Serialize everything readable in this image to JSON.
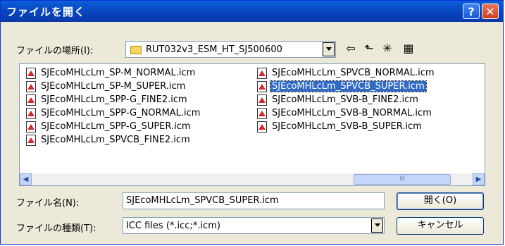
{
  "window": {
    "title": "ファイルを開く"
  },
  "titlebar": {
    "help_glyph": "?",
    "close_glyph": "✕"
  },
  "location": {
    "label": "ファイルの場所(I):",
    "folder": "RUT032v3_ESM_HT_SJ500600"
  },
  "toolbar": {
    "back_glyph": "⇦",
    "up_glyph": "⬑",
    "newfolder_glyph": "✳",
    "view_glyph": "▦"
  },
  "files": [
    {
      "name": "SJEcoMHLcLm_SP-M_NORMAL.icm",
      "selected": false
    },
    {
      "name": "SJEcoMHLcLm_SP-M_SUPER.icm",
      "selected": false
    },
    {
      "name": "SJEcoMHLcLm_SPP-G_FINE2.icm",
      "selected": false
    },
    {
      "name": "SJEcoMHLcLm_SPP-G_NORMAL.icm",
      "selected": false
    },
    {
      "name": "SJEcoMHLcLm_SPP-G_SUPER.icm",
      "selected": false
    },
    {
      "name": "SJEcoMHLcLm_SPVCB_FINE2.icm",
      "selected": false
    },
    {
      "name": "SJEcoMHLcLm_SPVCB_NORMAL.icm",
      "selected": false
    },
    {
      "name": "SJEcoMHLcLm_SPVCB_SUPER.icm",
      "selected": true
    },
    {
      "name": "SJEcoMHLcLm_SVB-B_FINE2.icm",
      "selected": false
    },
    {
      "name": "SJEcoMHLcLm_SVB-B_NORMAL.icm",
      "selected": false
    },
    {
      "name": "SJEcoMHLcLm_SVB-B_SUPER.icm",
      "selected": false
    }
  ],
  "scrollbar": {
    "left_glyph": "◀",
    "right_glyph": "▶",
    "thumb_grip": "III"
  },
  "filename": {
    "label": "ファイル名(N):",
    "value": "SJEcoMHLcLm_SPVCB_SUPER.icm"
  },
  "filetype": {
    "label": "ファイルの種類(T):",
    "value": "ICC files (*.icc;*.icm)"
  },
  "buttons": {
    "open": "開く(O)",
    "cancel": "キャンセル"
  },
  "colors": {
    "titlebar": "#0842bd",
    "selection": "#316ac5",
    "face": "#ece9d8"
  }
}
